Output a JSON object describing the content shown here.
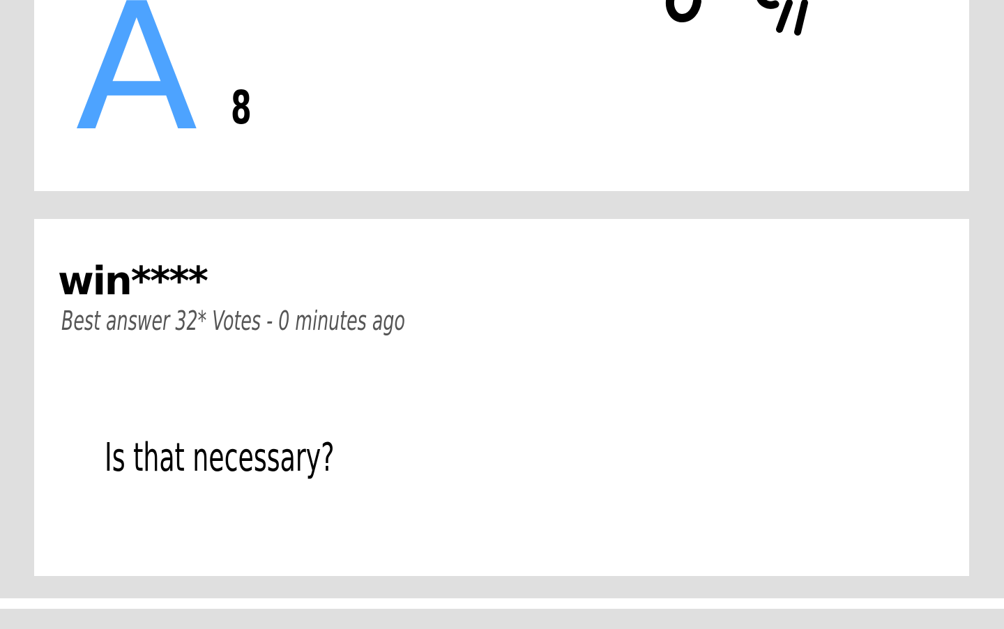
{
  "question": {
    "marker": "A",
    "count": "8"
  },
  "answer": {
    "author": "win****",
    "meta": "Best answer 32* Votes - 0 minutes ago",
    "text": "Is that necessary?"
  }
}
